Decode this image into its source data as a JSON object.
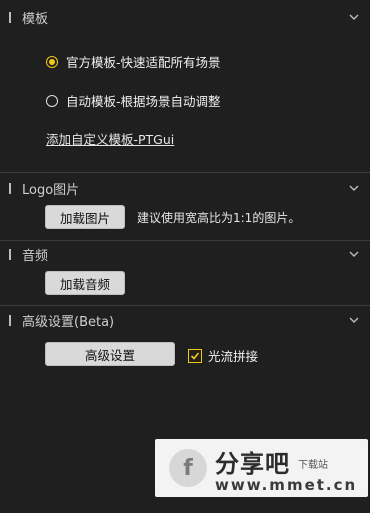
{
  "sections": {
    "template": {
      "title": "模板",
      "options": [
        {
          "label": "官方模板-快速适配所有场景",
          "selected": true
        },
        {
          "label": "自动模板-根据场景自动调整",
          "selected": false
        }
      ],
      "custom_link": "添加自定义模板-PTGui"
    },
    "logo": {
      "title": "Logo图片",
      "button": "加载图片",
      "hint": "建议使用宽高比为1:1的图片。"
    },
    "audio": {
      "title": "音频",
      "button": "加载音频"
    },
    "advanced": {
      "title": "高级设置(Beta)",
      "button": "高级设置",
      "checkbox_label": "光流拼接",
      "checkbox_checked": true
    }
  },
  "watermark": {
    "title": "分享吧",
    "subtitle": "下载站",
    "url": "www.mmet.cn"
  },
  "colors": {
    "background": "#1f1f1f",
    "accent": "#f2c811",
    "button_bg": "#d9d9d9"
  },
  "icons": [
    "chevron-down-icon",
    "radio-selected-icon",
    "radio-unselected-icon",
    "checkbox-checked-icon"
  ]
}
